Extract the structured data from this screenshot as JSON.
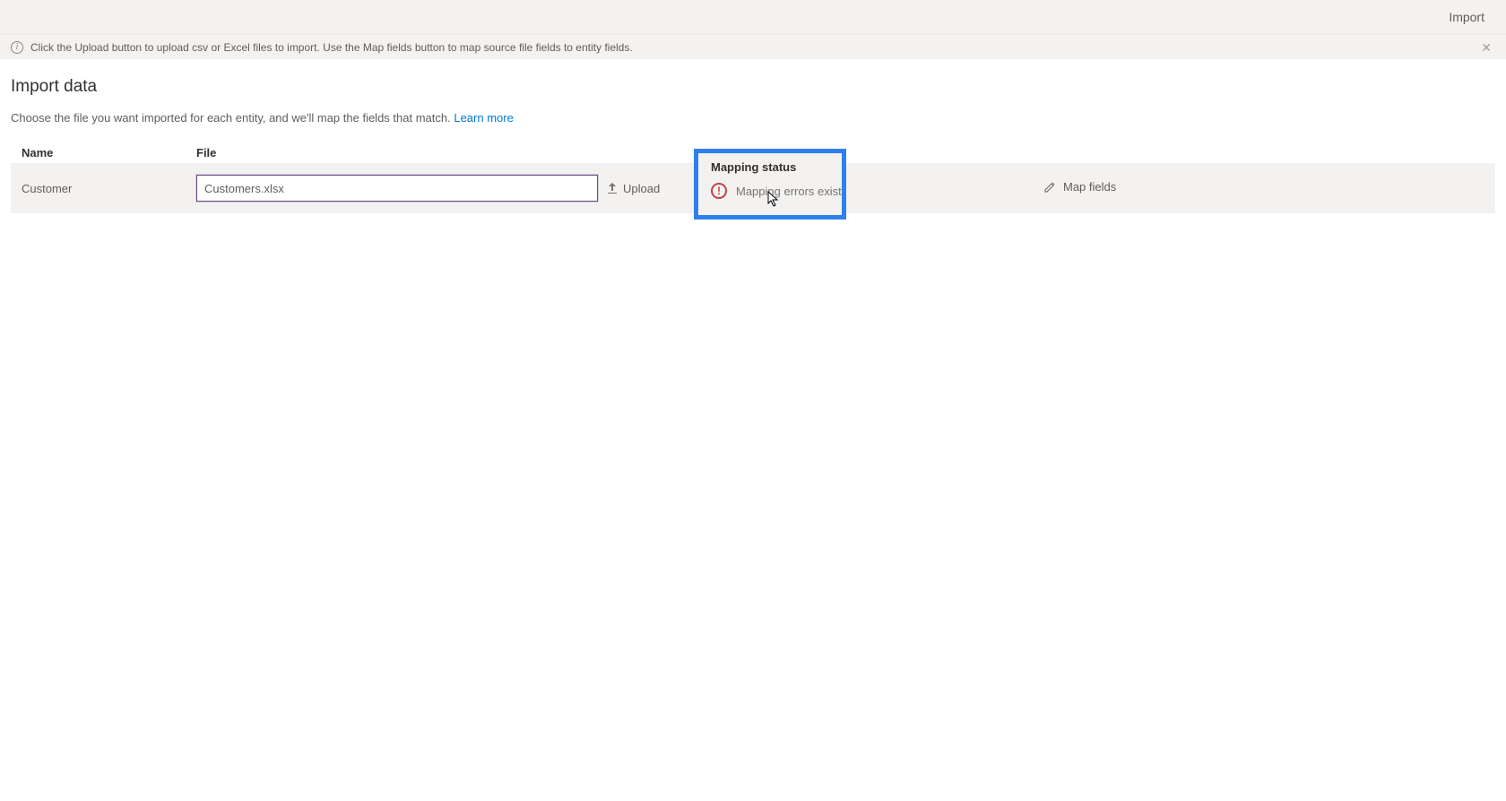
{
  "topbar": {
    "import_label": "Import"
  },
  "info": {
    "message": "Click the Upload button to upload csv or Excel files to import. Use the Map fields button to map source file fields to entity fields."
  },
  "page": {
    "title": "Import data",
    "subtitle": "Choose the file you want imported for each entity, and we'll map the fields that match. ",
    "learn_more": "Learn more"
  },
  "columns": {
    "name": "Name",
    "file": "File",
    "status": "Mapping status"
  },
  "row": {
    "entity": "Customer",
    "filename": "Customers.xlsx",
    "upload_label": "Upload",
    "status_text": "Mapping errors exist",
    "map_label": "Map fields"
  }
}
